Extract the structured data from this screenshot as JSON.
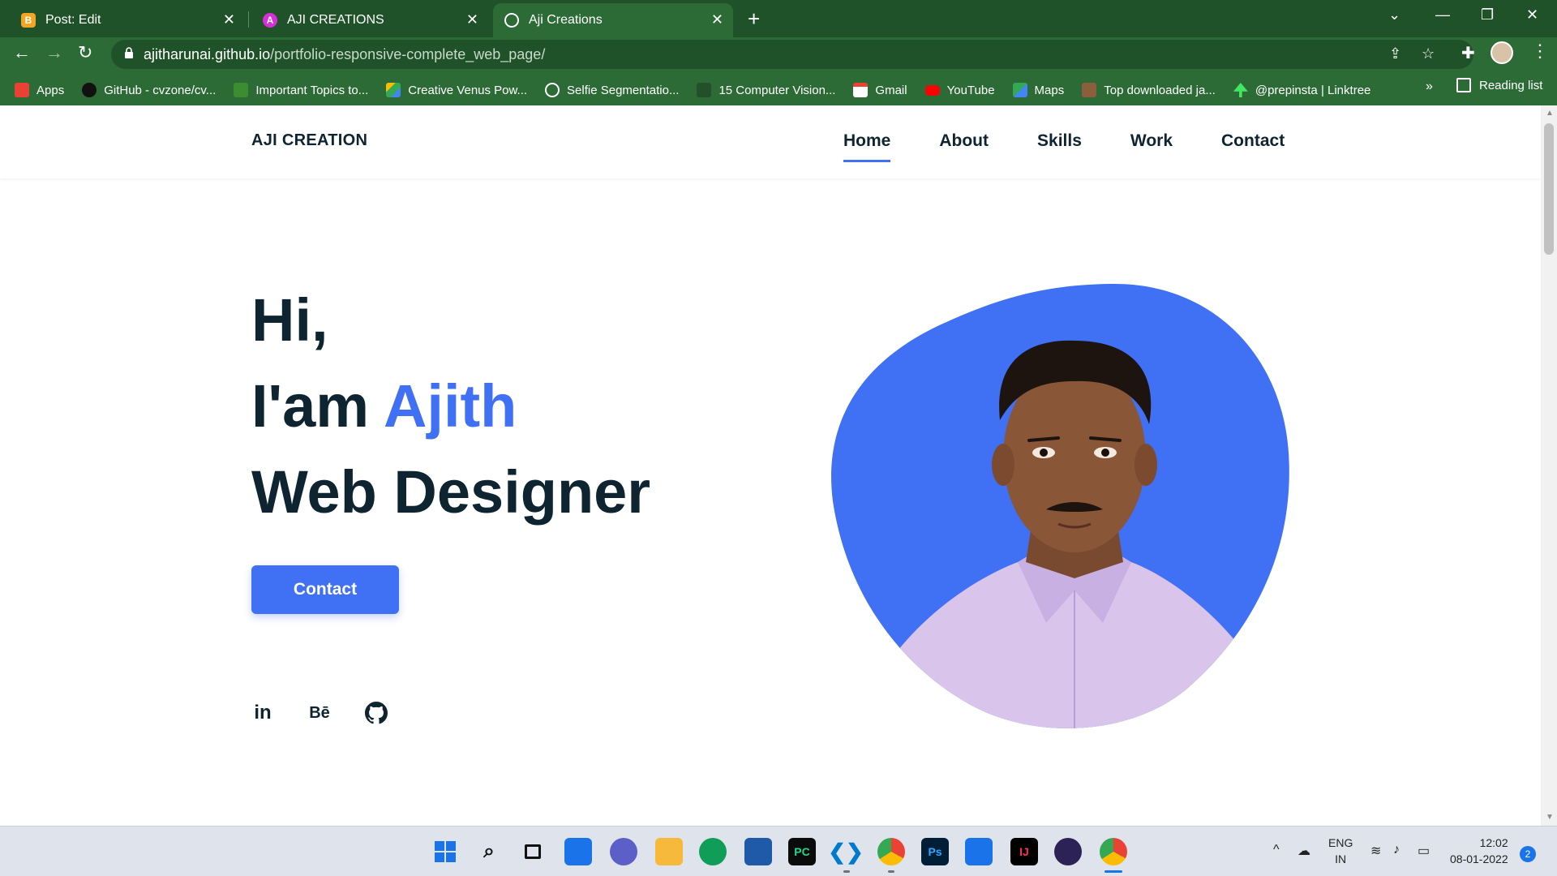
{
  "browser": {
    "tabs": [
      {
        "title": "Post: Edit",
        "favicon": "blogger-icon",
        "active": false
      },
      {
        "title": "AJI CREATIONS",
        "favicon": "site-a-icon",
        "active": false
      },
      {
        "title": "Aji Creations",
        "favicon": "globe-icon",
        "active": true
      }
    ],
    "url_host": "ajitharunai.github.io",
    "url_path": "/portfolio-responsive-complete_web_page/",
    "bookmarks": [
      {
        "label": "Apps",
        "icon": "apps-grid-icon",
        "color": "#e94235"
      },
      {
        "label": "GitHub - cvzone/cv...",
        "icon": "github-icon",
        "color": "#111111"
      },
      {
        "label": "Important Topics to...",
        "icon": "image-icon",
        "color": "#3c8d2f"
      },
      {
        "label": "Creative Venus Pow...",
        "icon": "drive-icon",
        "color": "#fbbc04"
      },
      {
        "label": "Selfie Segmentatio...",
        "icon": "globe-icon",
        "color": "#ffffff"
      },
      {
        "label": "15 Computer Vision...",
        "icon": "wave-icon",
        "color": "#2c6b35"
      },
      {
        "label": "Gmail",
        "icon": "gmail-icon",
        "color": "#ea4335"
      },
      {
        "label": "YouTube",
        "icon": "youtube-icon",
        "color": "#ff0000"
      },
      {
        "label": "Maps",
        "icon": "maps-icon",
        "color": "#34a853"
      },
      {
        "label": "Top downloaded ja...",
        "icon": "image-icon",
        "color": "#8b5e3c"
      },
      {
        "label": "@prepinsta | Linktree",
        "icon": "linktree-icon",
        "color": "#43e660"
      }
    ],
    "bookmarks_more": "»",
    "reading_list": "Reading list"
  },
  "site": {
    "logo": "AJI CREATION",
    "nav": [
      "Home",
      "About",
      "Skills",
      "Work",
      "Contact"
    ],
    "active_nav": "Home",
    "hero": {
      "line1": "Hi,",
      "line2_prefix": "I'am ",
      "line2_name": "Ajith",
      "line3": "Web Designer"
    },
    "contact_button": "Contact",
    "social": [
      {
        "label": "in",
        "icon": "linkedin-icon"
      },
      {
        "label": "Bē",
        "icon": "behance-icon"
      },
      {
        "label": "",
        "icon": "github-icon"
      }
    ]
  },
  "taskbar": {
    "language_line1": "ENG",
    "language_line2": "IN",
    "time": "12:02",
    "date": "08-01-2022",
    "notifications": "2"
  },
  "colors": {
    "accent": "#4070f4",
    "text_dark": "#0e2431",
    "chrome_dark": "#1f5228",
    "chrome": "#2c6b35"
  }
}
